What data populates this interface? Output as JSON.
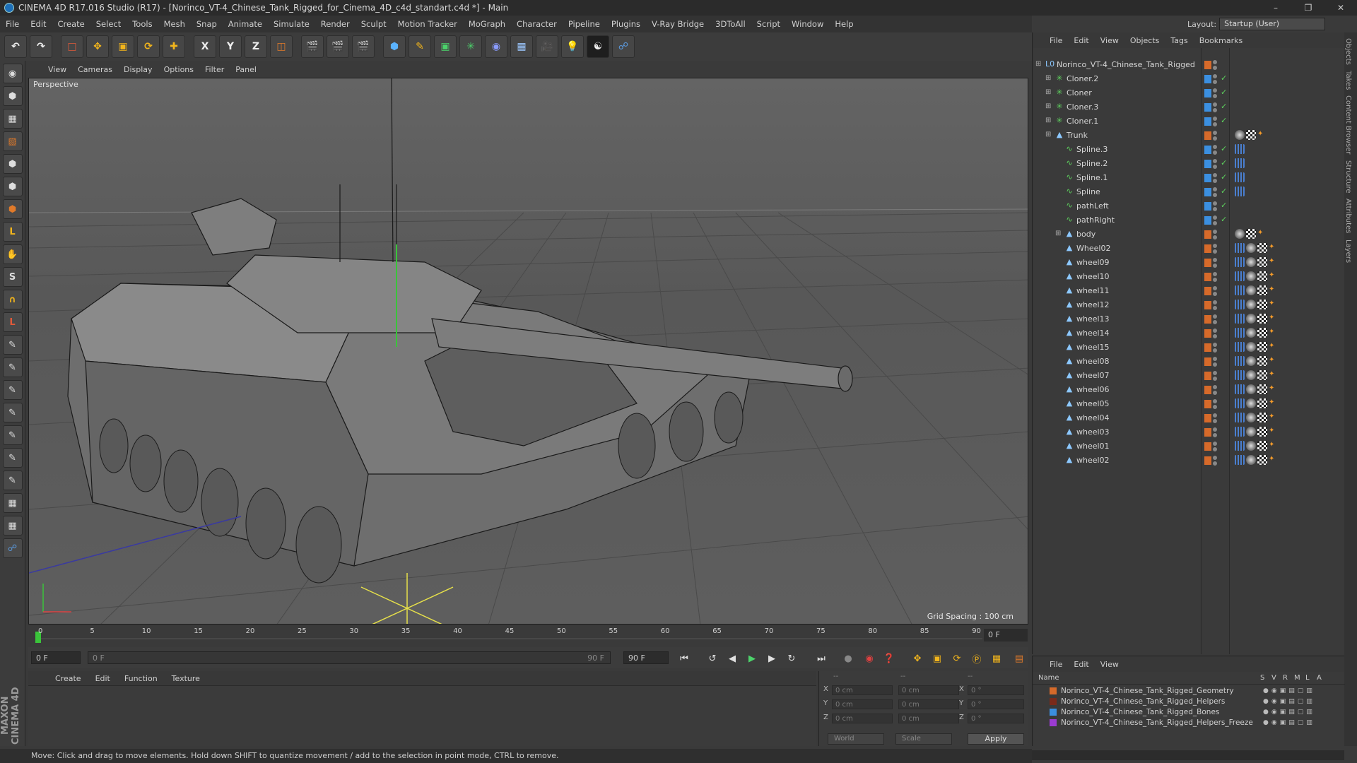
{
  "window": {
    "title": "CINEMA 4D R17.016 Studio (R17) - [Norinco_VT-4_Chinese_Tank_Rigged_for_Cinema_4D_c4d_standart.c4d *] - Main",
    "minimize": "–",
    "restore": "❐",
    "close": "✕"
  },
  "menu": [
    "File",
    "Edit",
    "Create",
    "Select",
    "Tools",
    "Mesh",
    "Snap",
    "Animate",
    "Simulate",
    "Render",
    "Sculpt",
    "Motion Tracker",
    "MoGraph",
    "Character",
    "Pipeline",
    "Plugins",
    "V-Ray Bridge",
    "3DToAll",
    "Script",
    "Window",
    "Help"
  ],
  "layout": {
    "label": "Layout:",
    "value": "Startup (User)"
  },
  "toolbar": {
    "axis_x": "X",
    "axis_y": "Y",
    "axis_z": "Z"
  },
  "viewport": {
    "menu": [
      "View",
      "Cameras",
      "Display",
      "Options",
      "Filter",
      "Panel"
    ],
    "label": "Perspective",
    "grid_spacing": "Grid Spacing : 100 cm"
  },
  "timeline": {
    "ticks": [
      "0",
      "5",
      "10",
      "15",
      "20",
      "25",
      "30",
      "35",
      "40",
      "45",
      "50",
      "55",
      "60",
      "65",
      "70",
      "75",
      "80",
      "85",
      "90"
    ],
    "current_frame": "0 F",
    "start_frame": "0 F",
    "range_start": "0 F",
    "range_end": "90 F",
    "end_frame": "90 F"
  },
  "materials": {
    "menu": [
      "Create",
      "Edit",
      "Function",
      "Texture"
    ]
  },
  "coords": {
    "head1": "--",
    "head2": "--",
    "head3": "--",
    "rows": [
      {
        "axis": "X",
        "pos": "0 cm",
        "size": "0 cm",
        "rot_axis": "X",
        "rot": "0 °"
      },
      {
        "axis": "Y",
        "pos": "0 cm",
        "size": "0 cm",
        "rot_axis": "Y",
        "rot": "0 °"
      },
      {
        "axis": "Z",
        "pos": "0 cm",
        "size": "0 cm",
        "rot_axis": "Z",
        "rot": "0 °"
      }
    ],
    "space": "World",
    "mode": "Scale",
    "apply": "Apply"
  },
  "status": "Move: Click and drag to move elements. Hold down SHIFT to quantize movement / add to the selection in point mode, CTRL to remove.",
  "logo": "MAXON CINEMA 4D",
  "objects": {
    "menu": [
      "File",
      "Edit",
      "View",
      "Objects",
      "Tags",
      "Bookmarks"
    ],
    "items": [
      {
        "name": "Norinco_VT-4_Chinese_Tank_Rigged",
        "indent": 0,
        "icon": "L0",
        "color": "#d66a2a"
      },
      {
        "name": "Cloner.2",
        "indent": 1,
        "icon": "✳",
        "color": "#3b8fe0"
      },
      {
        "name": "Cloner",
        "indent": 1,
        "icon": "✳",
        "color": "#3b8fe0"
      },
      {
        "name": "Cloner.3",
        "indent": 1,
        "icon": "✳",
        "color": "#3b8fe0"
      },
      {
        "name": "Cloner.1",
        "indent": 1,
        "icon": "✳",
        "color": "#3b8fe0"
      },
      {
        "name": "Trunk",
        "indent": 1,
        "icon": "▲",
        "color": "#d66a2a"
      },
      {
        "name": "Spline.3",
        "indent": 2,
        "icon": "∿",
        "color": "#3b8fe0"
      },
      {
        "name": "Spline.2",
        "indent": 2,
        "icon": "∿",
        "color": "#3b8fe0"
      },
      {
        "name": "Spline.1",
        "indent": 2,
        "icon": "∿",
        "color": "#3b8fe0"
      },
      {
        "name": "Spline",
        "indent": 2,
        "icon": "∿",
        "color": "#3b8fe0"
      },
      {
        "name": "pathLeft",
        "indent": 2,
        "icon": "∿",
        "color": "#3b8fe0"
      },
      {
        "name": "pathRight",
        "indent": 2,
        "icon": "∿",
        "color": "#3b8fe0"
      },
      {
        "name": "body",
        "indent": 2,
        "icon": "▲",
        "color": "#d66a2a"
      },
      {
        "name": "Wheel02",
        "indent": 2,
        "icon": "▲",
        "color": "#d66a2a"
      },
      {
        "name": "wheel09",
        "indent": 2,
        "icon": "▲",
        "color": "#d66a2a"
      },
      {
        "name": "wheel10",
        "indent": 2,
        "icon": "▲",
        "color": "#d66a2a"
      },
      {
        "name": "wheel11",
        "indent": 2,
        "icon": "▲",
        "color": "#d66a2a"
      },
      {
        "name": "wheel12",
        "indent": 2,
        "icon": "▲",
        "color": "#d66a2a"
      },
      {
        "name": "wheel13",
        "indent": 2,
        "icon": "▲",
        "color": "#d66a2a"
      },
      {
        "name": "wheel14",
        "indent": 2,
        "icon": "▲",
        "color": "#d66a2a"
      },
      {
        "name": "wheel15",
        "indent": 2,
        "icon": "▲",
        "color": "#d66a2a"
      },
      {
        "name": "wheel08",
        "indent": 2,
        "icon": "▲",
        "color": "#d66a2a"
      },
      {
        "name": "wheel07",
        "indent": 2,
        "icon": "▲",
        "color": "#d66a2a"
      },
      {
        "name": "wheel06",
        "indent": 2,
        "icon": "▲",
        "color": "#d66a2a"
      },
      {
        "name": "wheel05",
        "indent": 2,
        "icon": "▲",
        "color": "#d66a2a"
      },
      {
        "name": "wheel04",
        "indent": 2,
        "icon": "▲",
        "color": "#d66a2a"
      },
      {
        "name": "wheel03",
        "indent": 2,
        "icon": "▲",
        "color": "#d66a2a"
      },
      {
        "name": "wheel01",
        "indent": 2,
        "icon": "▲",
        "color": "#d66a2a"
      },
      {
        "name": "wheel02",
        "indent": 2,
        "icon": "▲",
        "color": "#d66a2a"
      }
    ]
  },
  "right_tabs": [
    "Objects",
    "Takes",
    "Content Browser",
    "Structure",
    "Attributes",
    "Layers"
  ],
  "layers": {
    "menu": [
      "File",
      "Edit",
      "View"
    ],
    "header": {
      "name": "Name",
      "s": "S",
      "v": "V",
      "r": "R",
      "m": "M",
      "l": "L",
      "a": "A"
    },
    "items": [
      {
        "name": "Norinco_VT-4_Chinese_Tank_Rigged_Geometry",
        "color": "#d66a2a"
      },
      {
        "name": "Norinco_VT-4_Chinese_Tank_Rigged_Helpers",
        "color": "#7a2a1a"
      },
      {
        "name": "Norinco_VT-4_Chinese_Tank_Rigged_Bones",
        "color": "#3b8fe0"
      },
      {
        "name": "Norinco_VT-4_Chinese_Tank_Rigged_Helpers_Freeze",
        "color": "#9b3bd1"
      }
    ]
  }
}
